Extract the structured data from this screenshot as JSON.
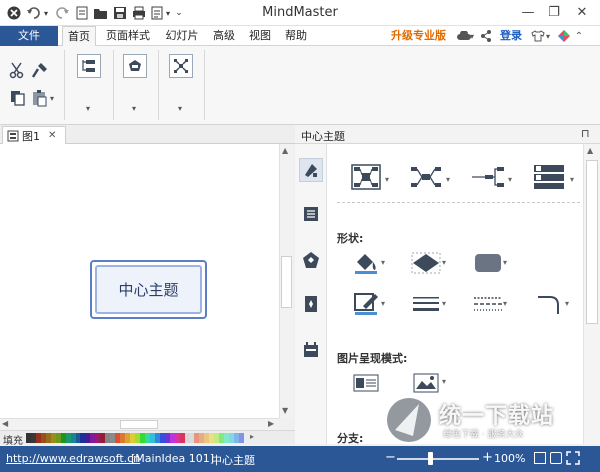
{
  "window": {
    "title": "MindMaster",
    "controls": {
      "minimize": "—",
      "restore": "❐",
      "close": "✕"
    }
  },
  "quick_access": [
    {
      "name": "app-logo-icon",
      "glyph": "⊗"
    },
    {
      "name": "undo-icon",
      "glyph": "↶"
    },
    {
      "name": "undo-dropdown-icon",
      "glyph": "▾"
    },
    {
      "name": "redo-icon",
      "glyph": "↷"
    },
    {
      "name": "open-folder-icon",
      "glyph": "🗁"
    },
    {
      "name": "open-file-icon",
      "glyph": "📂"
    },
    {
      "name": "save-icon",
      "glyph": "💾"
    },
    {
      "name": "print-icon",
      "glyph": "🖶"
    },
    {
      "name": "export-icon",
      "glyph": "🗎"
    },
    {
      "name": "export-dropdown-icon",
      "glyph": "▾"
    },
    {
      "name": "customize-toolbar-icon",
      "glyph": "⌄"
    }
  ],
  "tabs": {
    "file": "文件",
    "items": [
      "首页",
      "页面样式",
      "幻灯片",
      "高级",
      "视图",
      "帮助"
    ],
    "active_index": 0,
    "upgrade": "升级专业版",
    "login": "登录"
  },
  "doc_tab": {
    "label": "图1",
    "close": "✕"
  },
  "canvas": {
    "central_topic": "中心主题"
  },
  "panel": {
    "title": "中心主题",
    "pin": "⊓",
    "sections": {
      "shape": "形状:",
      "image_mode": "图片呈现模式:",
      "branch": "分支:"
    }
  },
  "palette": {
    "label": "填充"
  },
  "status": {
    "url": "http://www.edrawsoft.cn",
    "selection": "[MainIdea 101]",
    "topic": "中心主题",
    "zoom_out": "−",
    "zoom_in": "+",
    "zoom": "100%",
    "zoom_percent": 100
  },
  "watermark": {
    "text": "统一下载站",
    "sub": "绿色下载 · 服务大众"
  },
  "colors": {
    "accent": "#2b5797",
    "upgrade": "#e06a00",
    "login": "#1e5fc0",
    "topic_border": "#5a7fc4",
    "topic_fill": "#eef3fb",
    "icon_dark": "#3c4a5c"
  }
}
